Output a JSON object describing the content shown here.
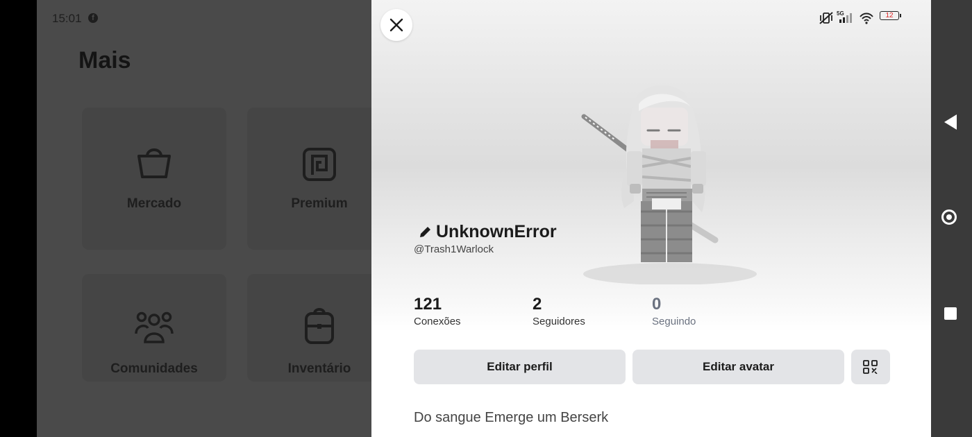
{
  "background": {
    "time": "15:01",
    "title": "Mais",
    "tiles": [
      {
        "label": "Mercado",
        "icon": "shopping-bag-icon"
      },
      {
        "label": "Premium",
        "icon": "premium-icon"
      },
      {
        "label": "Comunidades",
        "icon": "group-icon"
      },
      {
        "label": "Inventário",
        "icon": "backpack-icon"
      }
    ]
  },
  "status_bar": {
    "network": "5G",
    "battery": "12",
    "icons": [
      "mute-vibrate-icon",
      "signal-icon",
      "wifi-icon",
      "battery-icon"
    ]
  },
  "profile": {
    "display_name": "UnknownError",
    "username": "@Trash1Warlock",
    "stats": [
      {
        "value": "121",
        "label": "Conexões"
      },
      {
        "value": "2",
        "label": "Seguidores"
      },
      {
        "value": "0",
        "label": "Seguindo"
      }
    ],
    "buttons": {
      "edit_profile": "Editar perfil",
      "edit_avatar": "Editar avatar"
    },
    "bio": "Do sangue Emerge um Berserk"
  },
  "colors": {
    "sheet_bg": "#ffffff",
    "button_bg": "#e3e4e7",
    "muted_text": "#6b7280",
    "overlay": "#4a4a4a"
  }
}
